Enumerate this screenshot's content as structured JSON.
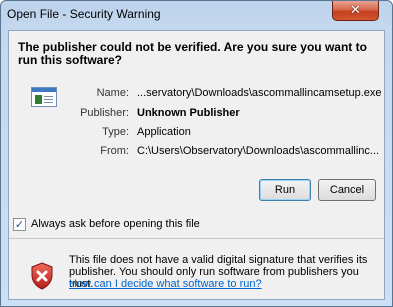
{
  "window": {
    "title": "Open File - Security Warning",
    "close_glyph": "✕"
  },
  "dialog": {
    "headline": "The publisher could not be verified.  Are you sure you want to run this software?",
    "icon": "application-icon",
    "fields": [
      {
        "label": "Name:",
        "value": "...servatory\\Downloads\\ascommallincamsetup.exe",
        "bold": false
      },
      {
        "label": "Publisher:",
        "value": "Unknown Publisher",
        "bold": true
      },
      {
        "label": "Type:",
        "value": "Application",
        "bold": false
      },
      {
        "label": "From:",
        "value": "C:\\Users\\Observatory\\Downloads\\ascommallinc...",
        "bold": false
      }
    ],
    "buttons": {
      "run": "Run",
      "cancel": "Cancel"
    },
    "checkbox": {
      "label": "Always ask before opening this file",
      "checked": true
    },
    "warning": {
      "icon": "shield-x-icon",
      "text": "This file does not have a valid digital signature that verifies its publisher.  You should only run software from publishers you trust.",
      "link": "How can I decide what software to run?"
    }
  },
  "colors": {
    "link": "#0066cc",
    "close_button": "#c4401f",
    "shield_red": "#c62828"
  }
}
